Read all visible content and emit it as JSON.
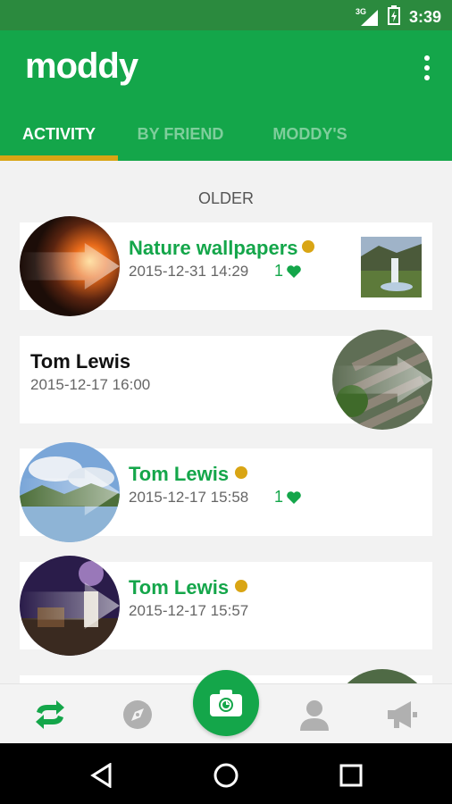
{
  "status_bar": {
    "network": "3G",
    "time": "3:39"
  },
  "app": {
    "logo": "moddy"
  },
  "tabs": [
    {
      "label": "ACTIVITY"
    },
    {
      "label": "BY FRIEND"
    },
    {
      "label": "MODDY'S"
    }
  ],
  "feed": {
    "section_label": "OLDER",
    "items": [
      {
        "name": "Nature wallpapers",
        "date": "2015-12-31 14:29",
        "likes": "1"
      },
      {
        "name": "Tom Lewis",
        "date": "2015-12-17 16:00"
      },
      {
        "name": "Tom Lewis",
        "date": "2015-12-17 15:58",
        "likes": "1"
      },
      {
        "name": "Tom Lewis",
        "date": "2015-12-17 15:57"
      }
    ]
  },
  "bottom_nav": {
    "items": [
      "refresh-icon",
      "compass-icon",
      "camera-icon",
      "person-icon",
      "megaphone-icon"
    ]
  },
  "colors": {
    "brand_green": "#14a64a",
    "accent_gold": "#d9a514"
  }
}
